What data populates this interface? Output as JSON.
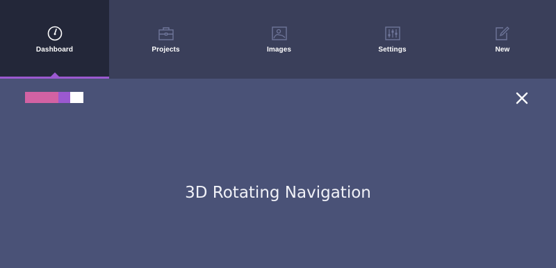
{
  "nav": {
    "items": [
      {
        "label": "Dashboard",
        "icon": "dashboard-gauge-icon",
        "active": true
      },
      {
        "label": "Projects",
        "icon": "briefcase-icon",
        "active": false
      },
      {
        "label": "Images",
        "icon": "image-icon",
        "active": false
      },
      {
        "label": "Settings",
        "icon": "sliders-icon",
        "active": false
      },
      {
        "label": "New",
        "icon": "edit-icon",
        "active": false
      }
    ],
    "active_accent": "#9b59d0"
  },
  "theme": {
    "swatches": [
      "#d262a3",
      "#9b59d0",
      "#ffffff"
    ]
  },
  "close": {
    "icon": "close-icon"
  },
  "main": {
    "title": "3D Rotating Navigation"
  },
  "colors": {
    "nav_bg": "#3a3f5a",
    "nav_active_bg": "#232739",
    "page_bg": "#4a5277"
  }
}
